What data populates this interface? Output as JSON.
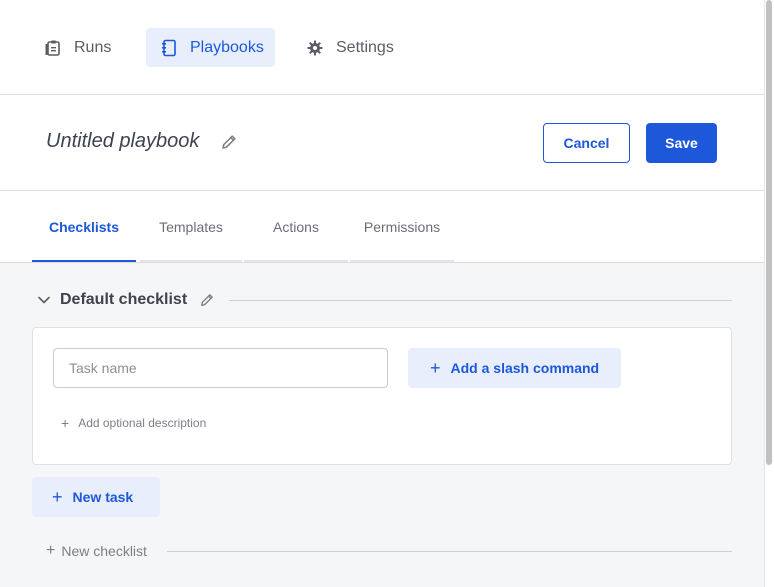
{
  "nav": {
    "items": [
      {
        "label": "Runs",
        "icon": "clipboard-icon"
      },
      {
        "label": "Playbooks",
        "icon": "notebook-icon"
      },
      {
        "label": "Settings",
        "icon": "gear-icon"
      }
    ],
    "active": "Playbooks"
  },
  "header": {
    "title": "Untitled playbook",
    "cancel_label": "Cancel",
    "save_label": "Save"
  },
  "tabs": [
    {
      "label": "Checklists"
    },
    {
      "label": "Templates"
    },
    {
      "label": "Actions"
    },
    {
      "label": "Permissions"
    }
  ],
  "checklist": {
    "title": "Default checklist",
    "task_input_placeholder": "Task name",
    "slash_command_label": "Add a slash command",
    "description_label": "Add optional description",
    "new_task_label": "New task",
    "new_checklist_label": "New checklist"
  },
  "colors": {
    "accent": "#1c58d9",
    "accent_light": "#e8eefb",
    "content_bg": "#f5f6f7"
  }
}
